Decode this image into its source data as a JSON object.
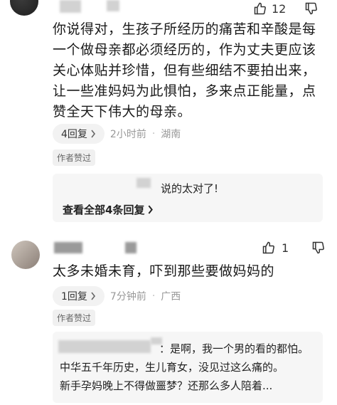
{
  "comment1": {
    "like_count": "12",
    "text": "你说得对，生孩子所经历的痛苦和辛酸是每一个做母亲都必须经历的，作为丈夫更应该关心体贴并珍惜，但有些细结不要拍出来，让一些准妈妈为此惧怕，多来点正能量，点赞全天下伟大的母亲。",
    "reply_count": "4回复",
    "time": "2小时前",
    "location": "湖南",
    "badge": "作者赞过",
    "reply_preview": "说的太对了!",
    "view_all": "查看全部4条回复"
  },
  "comment2": {
    "like_count": "1",
    "text": "太多未婚未育，吓到那些要做妈妈的",
    "reply_count": "1回复",
    "time": "7分钟前",
    "location": "广西",
    "badge": "作者赞过",
    "reply_lines": [
      "：是啊，我一个男的看的都怕。",
      "中华五千年历史，生儿育女，没见过这么痛的。",
      "新手孕妈晚上不得做噩梦？还那么多人陪着..."
    ]
  },
  "separator": "·",
  "icons": [
    "thumbs-up-icon",
    "thumbs-down-icon",
    "chevron-right-icon"
  ]
}
